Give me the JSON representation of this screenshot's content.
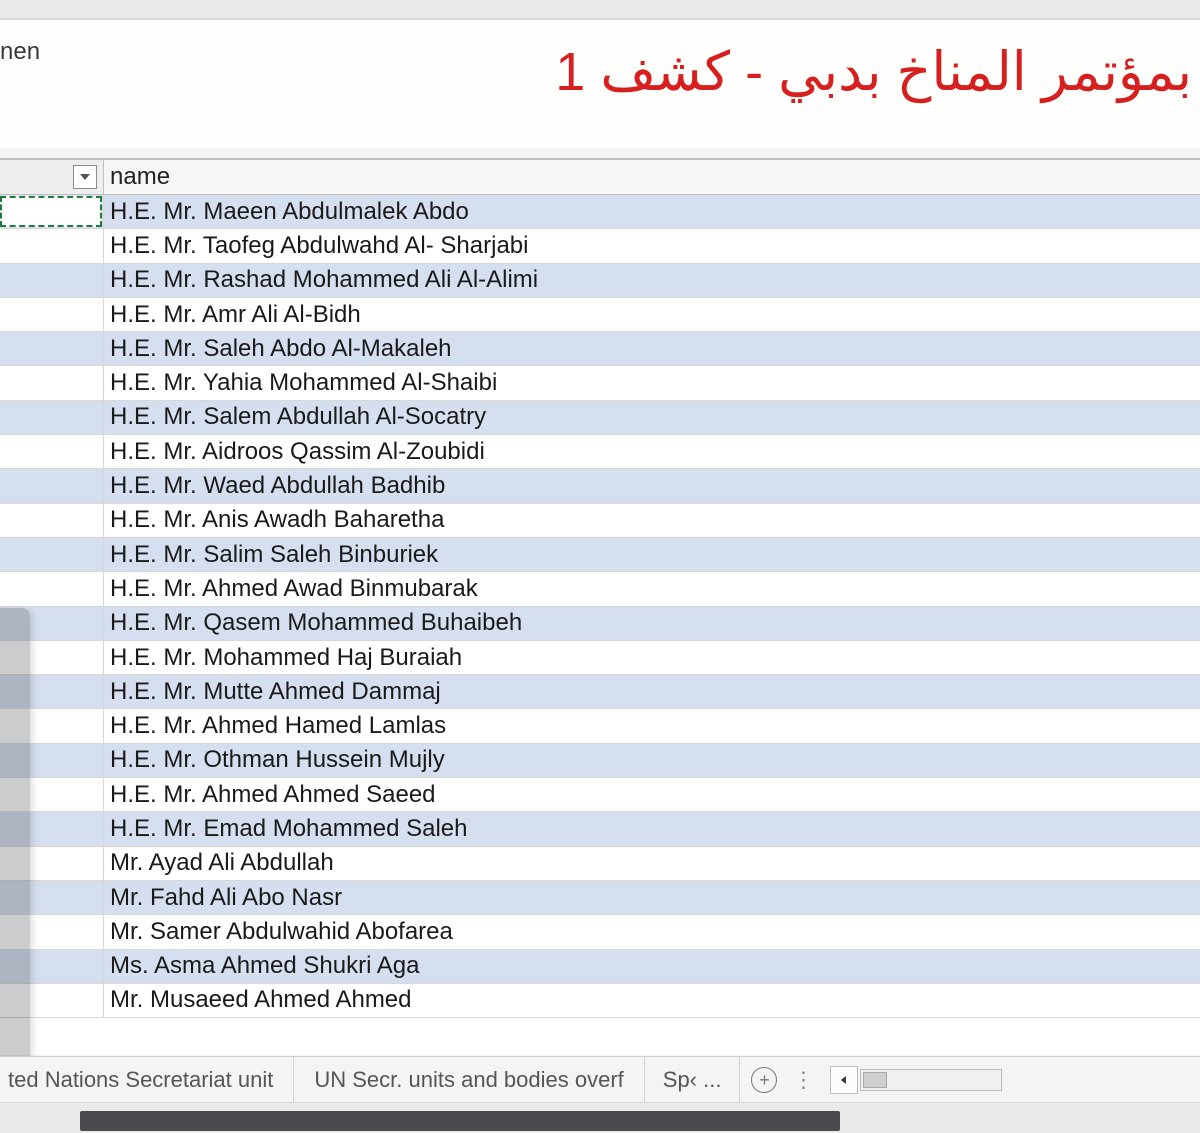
{
  "top_left_text": "nen",
  "arabic_title": "بمؤتمر المناخ  بدبي - كشف 1",
  "column_header": "name",
  "rows": [
    "H.E. Mr. Maeen Abdulmalek Abdo",
    "H.E. Mr. Taofeg Abdulwahd Al- Sharjabi",
    "H.E. Mr. Rashad Mohammed Ali Al-Alimi",
    "H.E. Mr. Amr Ali Al-Bidh",
    "H.E. Mr. Saleh Abdo Al-Makaleh",
    "H.E. Mr. Yahia Mohammed Al-Shaibi",
    "H.E. Mr. Salem Abdullah Al-Socatry",
    "H.E. Mr. Aidroos Qassim Al-Zoubidi",
    "H.E. Mr. Waed Abdullah Badhib",
    "H.E. Mr. Anis Awadh Baharetha",
    "H.E. Mr. Salim Saleh Binburiek",
    "H.E. Mr. Ahmed Awad Binmubarak",
    "H.E. Mr. Qasem Mohammed Buhaibeh",
    "H.E. Mr. Mohammed Haj Buraiah",
    "H.E. Mr. Mutte Ahmed Dammaj",
    "H.E. Mr. Ahmed Hamed Lamlas",
    "H.E. Mr. Othman Hussein Mujly",
    "H.E. Mr. Ahmed Ahmed Saeed",
    "H.E. Mr. Emad Mohammed Saleh",
    "Mr. Ayad Ali Abdullah",
    "Mr. Fahd Ali Abo Nasr",
    "Mr. Samer Abdulwahid Abofarea",
    "Ms. Asma Ahmed Shukri Aga",
    "Mr. Musaeed Ahmed Ahmed"
  ],
  "sheet_tabs": {
    "tab_0": "ted Nations Secretariat unit",
    "tab_1": "UN Secr. units and bodies overf",
    "tab_2": "Sp‹ ..."
  },
  "new_sheet_plus": "+",
  "tabs_dots": "⋮"
}
